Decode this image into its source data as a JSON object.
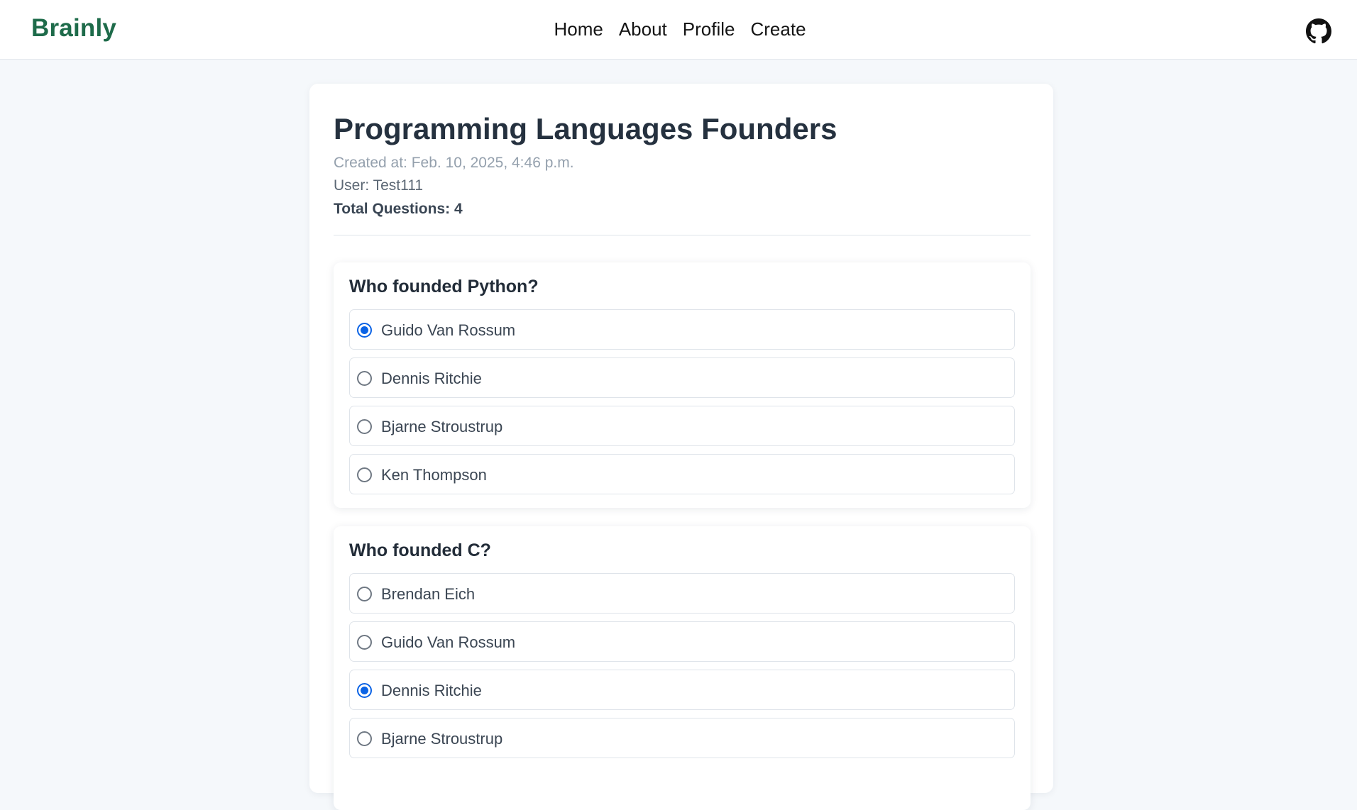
{
  "nav": {
    "brand": "Brainly",
    "links": [
      "Home",
      "About",
      "Profile",
      "Create"
    ],
    "github_icon": "github-icon"
  },
  "quiz": {
    "title": "Programming Languages Founders",
    "created_at": "Created at: Feb. 10, 2025, 4:46 p.m.",
    "user": "User: Test111",
    "total_questions": "Total Questions: 4",
    "questions": [
      {
        "text": "Who founded Python?",
        "options": [
          {
            "label": "Guido Van Rossum",
            "selected": true
          },
          {
            "label": "Dennis Ritchie",
            "selected": false
          },
          {
            "label": "Bjarne Stroustrup",
            "selected": false
          },
          {
            "label": "Ken Thompson",
            "selected": false
          }
        ]
      },
      {
        "text": "Who founded C?",
        "options": [
          {
            "label": "Brendan Eich",
            "selected": false
          },
          {
            "label": "Guido Van Rossum",
            "selected": false
          },
          {
            "label": "Dennis Ritchie",
            "selected": true
          },
          {
            "label": "Bjarne Stroustrup",
            "selected": false
          }
        ]
      }
    ]
  },
  "colors": {
    "brand": "#1e6b4a",
    "radio_selected": "#0b63e5",
    "page_bg": "#f5f8fb"
  }
}
